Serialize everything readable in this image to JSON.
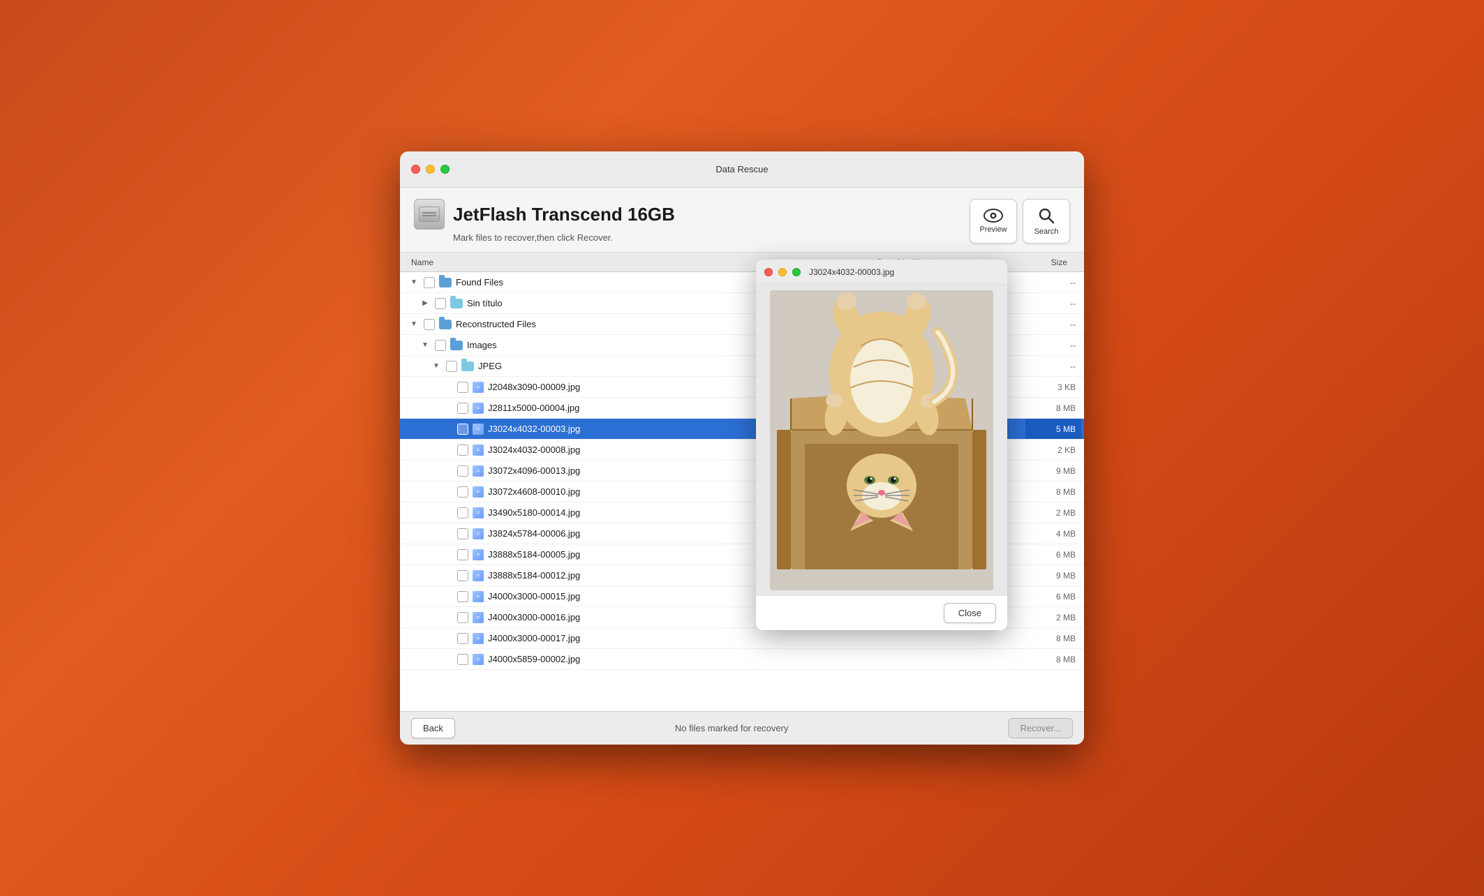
{
  "app": {
    "title": "Data Rescue"
  },
  "window": {
    "traffic_lights": {
      "close_label": "close",
      "minimize_label": "minimize",
      "maximize_label": "maximize"
    }
  },
  "header": {
    "drive_name": "JetFlash Transcend 16GB",
    "subtitle": "Mark files to recover,then click Recover.",
    "preview_label": "Preview",
    "search_label": "Search"
  },
  "table": {
    "col_name": "Name",
    "col_date": "Date Modified",
    "col_size": "Size",
    "rows": [
      {
        "id": 1,
        "indent": 0,
        "type": "folder-blue",
        "name": "Found Files",
        "date": "",
        "size": "--",
        "expanded": true,
        "checkbox": false
      },
      {
        "id": 2,
        "indent": 1,
        "type": "folder-light",
        "name": "Sin título",
        "date": "",
        "size": "--",
        "expanded": false,
        "checkbox": false
      },
      {
        "id": 3,
        "indent": 0,
        "type": "folder-blue",
        "name": "Reconstructed Files",
        "date": "",
        "size": "--",
        "expanded": true,
        "checkbox": false
      },
      {
        "id": 4,
        "indent": 1,
        "type": "folder-blue",
        "name": "Images",
        "date": "",
        "size": "--",
        "expanded": true,
        "checkbox": false
      },
      {
        "id": 5,
        "indent": 2,
        "type": "folder-light",
        "name": "JPEG",
        "date": "",
        "size": "--",
        "expanded": true,
        "checkbox": false
      },
      {
        "id": 6,
        "indent": 3,
        "type": "file-img",
        "name": "J2048x3090-00009.jpg",
        "date": "",
        "size": "3 KB",
        "expanded": false,
        "checkbox": false
      },
      {
        "id": 7,
        "indent": 3,
        "type": "file-img",
        "name": "J2811x5000-00004.jpg",
        "date": "",
        "size": "8 MB",
        "expanded": false,
        "checkbox": false
      },
      {
        "id": 8,
        "indent": 3,
        "type": "file-img",
        "name": "J3024x4032-00003.jpg",
        "date": "",
        "size": "5 MB",
        "expanded": false,
        "checkbox": false,
        "selected": true
      },
      {
        "id": 9,
        "indent": 3,
        "type": "file-img",
        "name": "J3024x4032-00008.jpg",
        "date": "",
        "size": "2 KB",
        "expanded": false,
        "checkbox": false
      },
      {
        "id": 10,
        "indent": 3,
        "type": "file-img",
        "name": "J3072x4096-00013.jpg",
        "date": "",
        "size": "9 MB",
        "expanded": false,
        "checkbox": false
      },
      {
        "id": 11,
        "indent": 3,
        "type": "file-img",
        "name": "J3072x4608-00010.jpg",
        "date": "",
        "size": "8 MB",
        "expanded": false,
        "checkbox": false
      },
      {
        "id": 12,
        "indent": 3,
        "type": "file-img",
        "name": "J3490x5180-00014.jpg",
        "date": "",
        "size": "2 MB",
        "expanded": false,
        "checkbox": false
      },
      {
        "id": 13,
        "indent": 3,
        "type": "file-img",
        "name": "J3824x5784-00006.jpg",
        "date": "",
        "size": "4 MB",
        "expanded": false,
        "checkbox": false
      },
      {
        "id": 14,
        "indent": 3,
        "type": "file-img",
        "name": "J3888x5184-00005.jpg",
        "date": "",
        "size": "6 MB",
        "expanded": false,
        "checkbox": false
      },
      {
        "id": 15,
        "indent": 3,
        "type": "file-img",
        "name": "J3888x5184-00012.jpg",
        "date": "",
        "size": "9 MB",
        "expanded": false,
        "checkbox": false
      },
      {
        "id": 16,
        "indent": 3,
        "type": "file-img",
        "name": "J4000x3000-00015.jpg",
        "date": "",
        "size": "6 MB",
        "expanded": false,
        "checkbox": false
      },
      {
        "id": 17,
        "indent": 3,
        "type": "file-img",
        "name": "J4000x3000-00016.jpg",
        "date": "",
        "size": "2 MB",
        "expanded": false,
        "checkbox": false
      },
      {
        "id": 18,
        "indent": 3,
        "type": "file-img",
        "name": "J4000x3000-00017.jpg",
        "date": "",
        "size": "8 MB",
        "expanded": false,
        "checkbox": false
      },
      {
        "id": 19,
        "indent": 3,
        "type": "file-img",
        "name": "J4000x5859-00002.jpg",
        "date": "",
        "size": "8 MB",
        "expanded": false,
        "checkbox": false
      }
    ]
  },
  "footer": {
    "back_label": "Back",
    "status_text": "No files marked for recovery",
    "recover_label": "Recover..."
  },
  "preview_popup": {
    "title": "J3024x4032-00003.jpg",
    "close_label": "Close"
  }
}
